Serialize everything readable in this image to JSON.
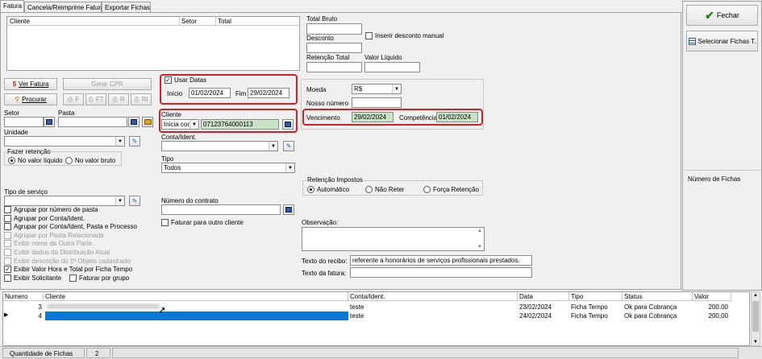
{
  "tabs": [
    "Fatura",
    "Cancela/Reimprime Fatura",
    "Exportar Fichas"
  ],
  "client_table": {
    "headers": [
      "Cliente",
      "Setor",
      "Total"
    ]
  },
  "totals": {
    "total_bruto": "Total Bruto",
    "desconto": "Desconto",
    "inserir_desconto": "Inserir desconto manual",
    "retencao_total": "Retenção Total",
    "valor_liquido": "Valor Líquido"
  },
  "actions": {
    "ver_fatura": "Ver Fatura",
    "gerar_cpr": "Gerar CPR",
    "procurar": "Procurar",
    "f": "F",
    "ft": "FT",
    "r": "R",
    "ri": "RI"
  },
  "left": {
    "setor": "Setor",
    "pasta": "Pasta",
    "unidade": "Unidade",
    "fazer_retencao": "Fazer retenção",
    "no_valor_liquido": "No valor líquido",
    "no_valor_bruto": "No valor bruto",
    "tipo_servico": "Tipo de serviço"
  },
  "options": [
    {
      "label": "Agrupar por número de pasta",
      "checked": false,
      "enabled": true
    },
    {
      "label": "Agrupar por Conta/Ident.",
      "checked": false,
      "enabled": true
    },
    {
      "label": "Agrupar por Conta/Ident, Pasta e Processo",
      "checked": false,
      "enabled": true
    },
    {
      "label": "Agrupar por Pasta Relacionada",
      "checked": false,
      "enabled": false
    },
    {
      "label": "Exibir nome da Outra Parte",
      "checked": false,
      "enabled": false
    },
    {
      "label": "Exibir dados da Distribuição Atual",
      "checked": false,
      "enabled": false
    },
    {
      "label": "Exibir descrição do 1º Objeto cadastrado",
      "checked": false,
      "enabled": false
    },
    {
      "label": "Exibir Valor Hora e Total por Ficha Tempo",
      "checked": true,
      "enabled": true
    }
  ],
  "exibir_solicitante": "Exibir Solicitante",
  "faturar_por_grupo": "Faturar por grupo",
  "datas": {
    "usar_datas": "Usar Datas",
    "inicio_label": "Início",
    "inicio": "01/02/2024",
    "fim_label": "Fim",
    "fim": "29/02/2024"
  },
  "cliente": {
    "label": "Cliente",
    "mode": "Inicia com",
    "value": "07123764000113"
  },
  "conta_ident": "Conta/Ident.",
  "tipo": {
    "label": "Tipo",
    "value": "Todos"
  },
  "numero_contrato": "Número do contrato",
  "faturar_outro": "Faturar para outro cliente",
  "moeda": {
    "label": "Moeda",
    "value": "R$"
  },
  "nosso_numero": "Nosso número",
  "vencimento": {
    "label": "Vencimento",
    "value": "29/02/2024"
  },
  "competencia": {
    "label": "Competência",
    "value": "01/02/2024"
  },
  "retencao_impostos": {
    "label": "Retenção Impostos",
    "automatico": "Automático",
    "nao_reter": "Não Reter",
    "forca": "Força Retenção"
  },
  "observacao": "Observação:",
  "texto_recibo": {
    "label": "Texto do recibo:",
    "value": "referente a honorários de serviços profissionais prestados."
  },
  "texto_fatura": "Texto da fatura:",
  "side": {
    "fechar": "Fechar",
    "selecionar": "Selecionar Fichas T.",
    "numero_fichas": "Número de Fichas"
  },
  "grid": {
    "headers": [
      "Numero",
      "Cliente",
      "Conta/Ident.",
      "Data",
      "Tipo",
      "Status",
      "Valor"
    ],
    "rows": [
      {
        "numero": "3",
        "conta": "teste",
        "data": "23/02/2024",
        "tipo": "Ficha Tempo",
        "status": "Ok para Cobrança",
        "valor": "200,00"
      },
      {
        "numero": "4",
        "conta": "teste",
        "data": "24/02/2024",
        "tipo": "Ficha Tempo",
        "status": "Ok para Cobrança",
        "valor": "200,00"
      }
    ]
  },
  "footer": {
    "label": "Quantidade de Fichas",
    "value": "2"
  },
  "colors": {
    "highlight_red": "#d32020",
    "selection_blue": "#0a78d7",
    "date_green": "#c9e3c7"
  }
}
